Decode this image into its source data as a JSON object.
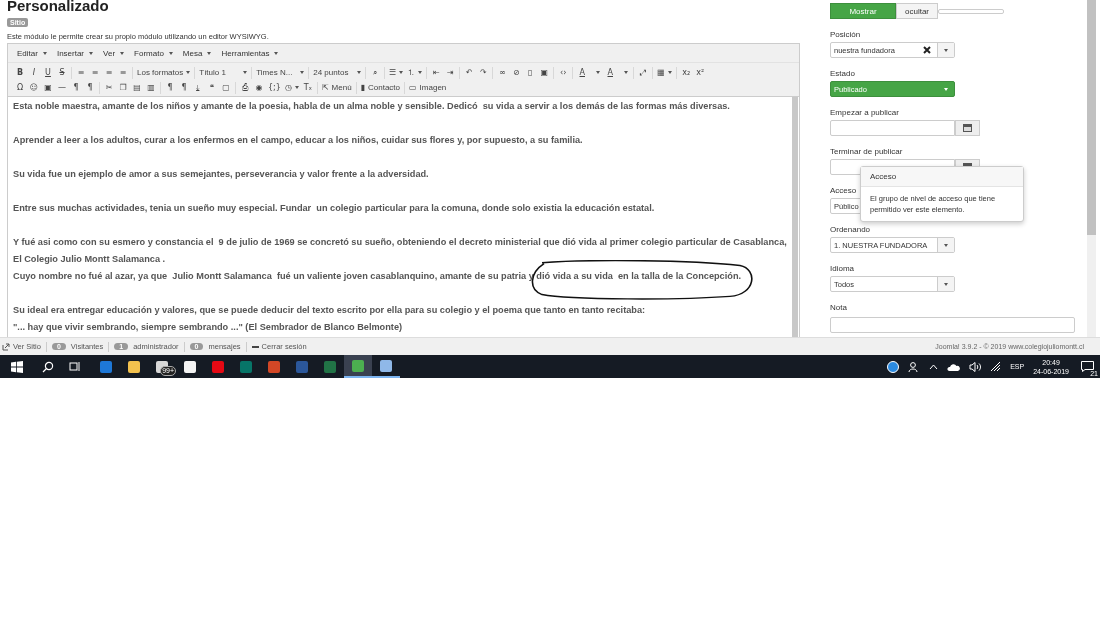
{
  "page": {
    "title": "Personalizado",
    "badge": "Sitio",
    "description": "Este módulo le permite crear su propio módulo utilizando un editor WYSIWYG."
  },
  "editor": {
    "menus": [
      {
        "label": "Editar"
      },
      {
        "label": "Insertar"
      },
      {
        "label": "Ver"
      },
      {
        "label": "Formato"
      },
      {
        "label": "Mesa"
      },
      {
        "label": "Herramientas"
      }
    ],
    "toolbar_rows": [
      [
        {
          "items": [
            {
              "kind": "bold",
              "text": "B"
            },
            {
              "kind": "italic",
              "text": "I"
            },
            {
              "kind": "underline",
              "text": "U"
            },
            {
              "kind": "strike",
              "text": "S"
            }
          ]
        },
        {
          "items": [
            {
              "kind": "button",
              "text": "≡"
            },
            {
              "kind": "button",
              "text": "≡"
            },
            {
              "kind": "button",
              "text": "≡"
            },
            {
              "kind": "button",
              "text": "≡"
            }
          ]
        },
        {
          "items": [
            {
              "kind": "menu",
              "text": "Los formatos"
            }
          ]
        },
        {
          "items": [
            {
              "kind": "select",
              "text": "Título 1"
            }
          ]
        },
        {
          "items": [
            {
              "kind": "select",
              "text": "Times N..."
            }
          ]
        },
        {
          "items": [
            {
              "kind": "select",
              "text": "24 puntos"
            }
          ]
        },
        {
          "items": [
            {
              "kind": "button",
              "text": "⌕"
            }
          ]
        },
        {
          "items": [
            {
              "kind": "menu",
              "text": "☰"
            },
            {
              "kind": "menu",
              "text": "⒈"
            }
          ]
        },
        {
          "items": [
            {
              "kind": "button",
              "text": "⇤"
            },
            {
              "kind": "button",
              "text": "⇥"
            }
          ]
        },
        {
          "items": [
            {
              "kind": "button",
              "text": "↶"
            },
            {
              "kind": "button",
              "text": "↷"
            }
          ]
        },
        {
          "items": [
            {
              "kind": "button",
              "text": "∞"
            },
            {
              "kind": "button",
              "text": "⊘"
            },
            {
              "kind": "button",
              "text": "▯"
            },
            {
              "kind": "button",
              "text": "▣"
            }
          ]
        },
        {
          "items": [
            {
              "kind": "button",
              "text": "‹›"
            }
          ]
        },
        {
          "items": [
            {
              "kind": "underline",
              "text": "A"
            },
            {
              "kind": "menu"
            },
            {
              "kind": "underline",
              "text": "A"
            },
            {
              "kind": "menu"
            }
          ]
        },
        {
          "items": [
            {
              "kind": "button",
              "text": "⤢"
            }
          ]
        },
        {
          "items": [
            {
              "kind": "menu",
              "text": "▦"
            }
          ]
        },
        {
          "items": [
            {
              "kind": "button",
              "text": "x₂"
            },
            {
              "kind": "button",
              "text": "x²"
            }
          ]
        }
      ],
      [
        {
          "items": [
            {
              "kind": "button",
              "text": "Ω"
            },
            {
              "kind": "button",
              "text": "☺"
            },
            {
              "kind": "button",
              "text": "▣"
            },
            {
              "kind": "button",
              "text": "—"
            },
            {
              "kind": "button",
              "text": "¶"
            },
            {
              "kind": "button",
              "text": "¶"
            }
          ]
        },
        {
          "items": [
            {
              "kind": "button",
              "text": "✂"
            },
            {
              "kind": "button",
              "text": "❐"
            },
            {
              "kind": "button",
              "text": "▤"
            },
            {
              "kind": "button",
              "text": "▥"
            }
          ]
        },
        {
          "items": [
            {
              "kind": "button",
              "text": "¶"
            },
            {
              "kind": "button",
              "text": "¶"
            },
            {
              "kind": "button",
              "text": "⤓"
            },
            {
              "kind": "button",
              "text": "❝"
            },
            {
              "kind": "button",
              "text": "▢"
            }
          ]
        },
        {
          "items": [
            {
              "kind": "button",
              "text": "⎙"
            },
            {
              "kind": "button",
              "text": "◉"
            },
            {
              "kind": "button",
              "text": "{;}"
            },
            {
              "kind": "menu",
              "text": "◷"
            },
            {
              "kind": "button",
              "text": "Tₓ"
            }
          ]
        },
        {
          "items": [
            {
              "kind": "labeled",
              "icon": "⇱",
              "text": "Menú"
            }
          ]
        },
        {
          "items": [
            {
              "kind": "labeled",
              "icon": "▮",
              "text": "Contacto"
            }
          ]
        },
        {
          "items": [
            {
              "kind": "labeled",
              "icon": "▭",
              "text": "Imagen"
            }
          ]
        }
      ]
    ],
    "paragraphs": [
      {
        "lines": [
          "Esta noble maestra, amante de los niños y amante de la poesia, habla de un alma noble y sensible. Dedicó  su vida a servir a los demás de las formas más diversas."
        ]
      },
      {
        "lines": [
          "Aprender a leer a los adultos, curar a los enfermos en el campo, educar a los niños, cuidar sus flores y, por supuesto, a su familia."
        ]
      },
      {
        "lines": [
          "Su vida fue un ejemplo de amor a sus semejantes, perseverancia y valor frente a la adversidad."
        ]
      },
      {
        "lines": [
          "Entre sus muchas actividades, tenia un sueño muy especial. Fundar  un colegio particular para la comuna, donde solo existia la educación estatal."
        ]
      },
      {
        "lines": [
          "Y fué asi como con su esmero y constancia el  9 de julio de 1969 se concretó su sueño, obteniendo el decreto ministerial que dió vida al primer colegio particular de Casablanca,",
          "El Colegio Julio Montt Salamanca .",
          "Cuyo nombre no fué al azar, ya que  Julio Montt Salamanca  fué un valiente joven casablanquino, amante de su patria y dió vida a su vida  en la talla de la Concepción."
        ]
      },
      {
        "lines": [
          "Su ideal era entregar educación y valores, que se puede deducir del texto escrito por ella para su colegio y el poema que tanto en tanto recitaba:",
          "\"... hay que vivir sembrando, siempre sembrando ...\" (El Sembrador de Blanco Belmonte)"
        ]
      }
    ]
  },
  "sidebar": {
    "toggle": [
      {
        "label": "Mostrar",
        "selected": true
      },
      {
        "label": "ocultar",
        "selected": false
      }
    ],
    "fields": [
      {
        "kind": "select",
        "label": "Posición",
        "value": "nuestra fundadora",
        "clearable": true
      },
      {
        "kind": "status",
        "label": "Estado",
        "value": "Publicado"
      },
      {
        "kind": "date",
        "label": "Empezar a publicar"
      },
      {
        "kind": "date",
        "label": "Terminar de publicar"
      },
      {
        "kind": "select",
        "label": "Acceso",
        "value": "Público"
      },
      {
        "kind": "select",
        "label": "Ordenando",
        "value": "1. NUESTRA FUNDADORA",
        "clearable": false
      },
      {
        "kind": "select",
        "label": "Idioma",
        "value": "Todos",
        "clearable": false
      },
      {
        "kind": "text",
        "label": "Nota"
      }
    ]
  },
  "tooltip": {
    "title": "Acceso",
    "text": "El grupo de nivel de acceso que tiene permitido ver este elemento."
  },
  "status_bar": {
    "view_site": "Ver Sitio",
    "counters": [
      {
        "count": "0",
        "label": "Visitantes"
      },
      {
        "count": "1",
        "label": "administrador"
      },
      {
        "count": "0",
        "label": "mensajes"
      }
    ],
    "logout": "Cerrar sesión",
    "footer": "Joomla! 3.9.2 - © 2019 www.colegiojuliomontt.cl"
  },
  "taskbar": {
    "apps": [
      {
        "color": "#1e78d7",
        "running": false,
        "selected": false
      },
      {
        "color": "#f2c14e",
        "running": false,
        "selected": false
      },
      {
        "color": "#d8d8d8",
        "running": false,
        "selected": false,
        "badge": "99+"
      },
      {
        "color": "#f4f4f4",
        "running": false,
        "selected": false
      },
      {
        "color": "#e50914",
        "running": false,
        "selected": false
      },
      {
        "color": "#077568",
        "running": false,
        "selected": false
      },
      {
        "color": "#d24726",
        "running": false,
        "selected": false
      },
      {
        "color": "#2b579a",
        "running": false,
        "selected": false
      },
      {
        "color": "#217346",
        "running": false,
        "selected": false
      },
      {
        "color": "#4caf50",
        "running": true,
        "selected": true
      },
      {
        "color": "#8fb8e8",
        "running": true,
        "selected": false
      }
    ],
    "tray": {
      "language": "ESP",
      "time": "20:49",
      "date": "24-06-2019",
      "notifications": "21"
    }
  }
}
